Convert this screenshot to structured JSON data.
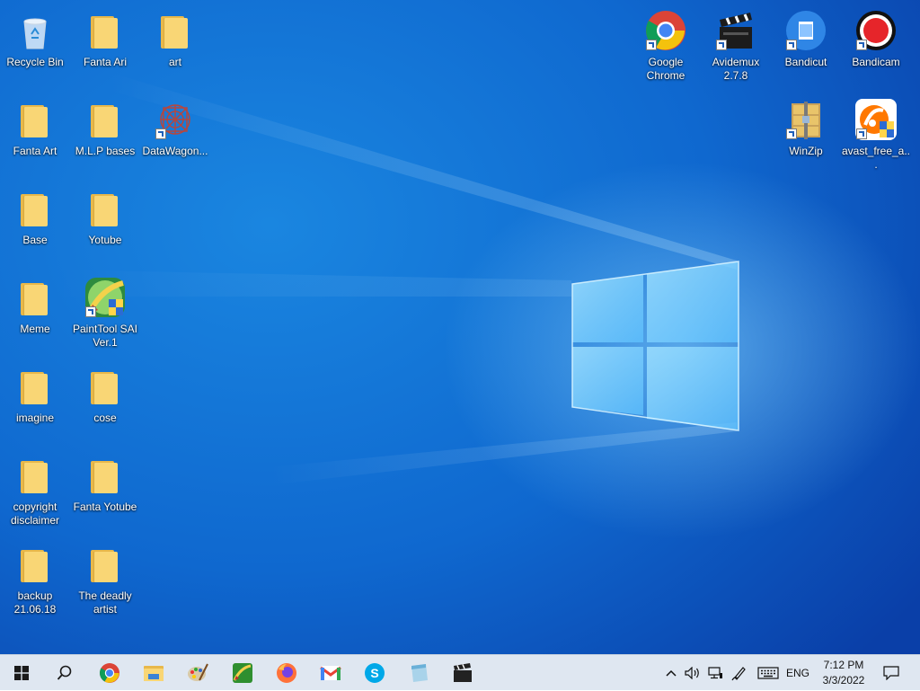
{
  "desktop": {
    "left_icons": [
      {
        "name": "recycle-bin-icon",
        "label": "Recycle Bin",
        "kind": "recycle"
      },
      {
        "name": "folder-fanta-ari",
        "label": "Fanta Ari",
        "kind": "folder"
      },
      {
        "name": "folder-art",
        "label": "art",
        "kind": "folder"
      },
      {
        "name": "folder-fanta-art",
        "label": "Fanta Art",
        "kind": "folder"
      },
      {
        "name": "folder-mlp-bases",
        "label": "M.L.P bases",
        "kind": "folder"
      },
      {
        "name": "datawagon-shortcut",
        "label": "DataWagon...",
        "kind": "datawagon"
      },
      {
        "name": "folder-base",
        "label": "Base",
        "kind": "folder"
      },
      {
        "name": "folder-yotube",
        "label": "Yotube",
        "kind": "folder"
      },
      {
        "name": "folder-meme",
        "label": "Meme",
        "kind": "folder"
      },
      {
        "name": "painttool-sai-shortcut",
        "label": "PaintTool SAI Ver.1",
        "kind": "sai"
      },
      {
        "name": "folder-imagine",
        "label": "imagine",
        "kind": "folder"
      },
      {
        "name": "folder-cose",
        "label": "cose",
        "kind": "folder"
      },
      {
        "name": "folder-copyright-disclaimer",
        "label": "copyright disclaimer",
        "kind": "folder"
      },
      {
        "name": "folder-fanta-yotube",
        "label": "Fanta Yotube",
        "kind": "folder"
      },
      {
        "name": "folder-backup",
        "label": "backup 21.06.18",
        "kind": "folder"
      },
      {
        "name": "folder-the-deadly-artist",
        "label": "The deadly artist",
        "kind": "folder"
      }
    ],
    "right_icons": [
      {
        "name": "google-chrome-shortcut",
        "label": "Google Chrome",
        "kind": "chrome"
      },
      {
        "name": "avidemux-shortcut",
        "label": "Avidemux 2.7.8",
        "kind": "avidemux"
      },
      {
        "name": "bandicut-shortcut",
        "label": "Bandicut",
        "kind": "bandicut"
      },
      {
        "name": "bandicam-shortcut",
        "label": "Bandicam",
        "kind": "bandicam"
      },
      {
        "name": "winzip-shortcut",
        "label": "WinZip",
        "kind": "winzip"
      },
      {
        "name": "avast-shortcut",
        "label": "avast_free_a...",
        "kind": "avast"
      }
    ]
  },
  "taskbar": {
    "pinned": [
      {
        "name": "start-button",
        "icon": "windows-icon"
      },
      {
        "name": "search-button",
        "icon": "search-icon"
      },
      {
        "name": "taskbar-chrome",
        "icon": "chrome-icon"
      },
      {
        "name": "taskbar-file-explorer",
        "icon": "file-explorer-icon"
      },
      {
        "name": "taskbar-paint",
        "icon": "paint-palette-icon"
      },
      {
        "name": "taskbar-painttool-sai",
        "icon": "painttool-sai-icon"
      },
      {
        "name": "taskbar-firefox",
        "icon": "firefox-icon"
      },
      {
        "name": "taskbar-gmail",
        "icon": "gmail-icon"
      },
      {
        "name": "taskbar-skype",
        "icon": "skype-icon"
      },
      {
        "name": "taskbar-app",
        "icon": "document-tool-icon"
      },
      {
        "name": "taskbar-avidemux",
        "icon": "clapperboard-icon"
      }
    ],
    "tray": {
      "language": "ENG",
      "time": "7:12 PM",
      "date": "3/3/2022"
    }
  },
  "colors": {
    "wallpaper_blue": "#0f68cf",
    "folder_yellow": "#f9d675",
    "taskbar_bg": "#dfe7f1"
  }
}
